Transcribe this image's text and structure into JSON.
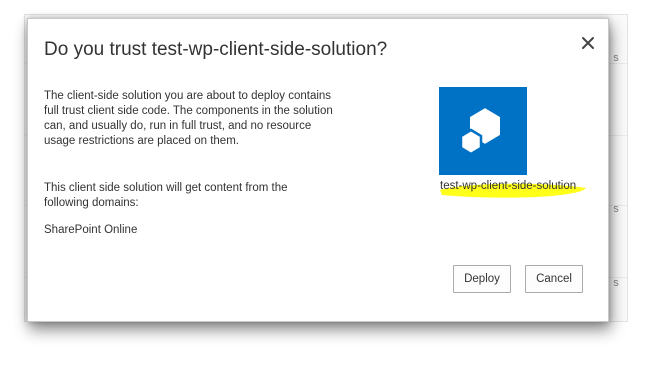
{
  "dialog": {
    "title": "Do you trust test-wp-client-side-solution?",
    "close_glyph": "✕",
    "paragraph_1": "The client-side solution you are about to deploy contains full trust client side code. The components in the solution can, and usually do, run in full trust, and no resource usage restrictions are placed on them.",
    "paragraph_2": "This client side solution will get content from the following domains:",
    "domain_1": "SharePoint Online",
    "solution_name": "test-wp-client-side-solution",
    "buttons": {
      "deploy": "Deploy",
      "cancel": "Cancel"
    }
  },
  "background": {
    "fragment_s": "s"
  },
  "icons": {
    "close": "close-icon",
    "app_tile": "app-package-icon"
  },
  "colors": {
    "tile_blue": "#0072c6",
    "highlight_yellow": "#ffff00"
  }
}
